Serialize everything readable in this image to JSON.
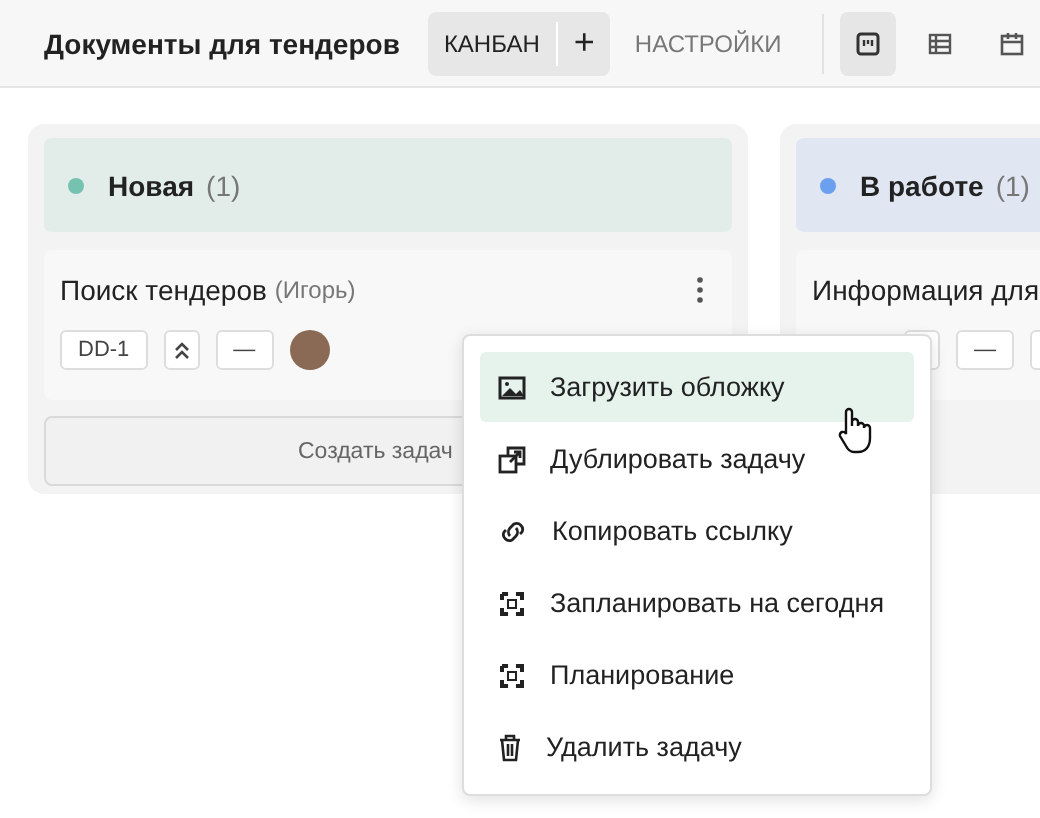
{
  "header": {
    "title": "Документы для тендеров",
    "tabs": [
      {
        "label": "КАНБАН",
        "selected": true
      },
      {
        "label": "НАСТРОЙКИ",
        "selected": false
      }
    ],
    "add_label": "+",
    "views": [
      {
        "kind": "kanban",
        "selected": true
      },
      {
        "kind": "table",
        "selected": false
      },
      {
        "kind": "calendar",
        "selected": false
      }
    ]
  },
  "columns": [
    {
      "name": "Новая",
      "count": "(1)",
      "color": "#76c2b0",
      "cards": [
        {
          "title": "Поиск тендеров",
          "assignee": "(Игорь)",
          "badges": [
            {
              "kind": "id",
              "text": "DD-1"
            },
            {
              "kind": "priority"
            },
            {
              "kind": "text",
              "text": "—"
            },
            {
              "kind": "avatar"
            }
          ]
        }
      ],
      "create_label": "Создать задач"
    },
    {
      "name": "В работе",
      "count": "(1)",
      "color": "#6aa0ee",
      "cards": [
        {
          "title": "Информация для",
          "badges": [
            {
              "kind": "priority"
            },
            {
              "kind": "text",
              "text": "—"
            },
            {
              "kind": "date"
            }
          ]
        }
      ]
    }
  ],
  "menu": {
    "items": [
      {
        "kind": "image",
        "label": "Загрузить обложку",
        "selected": true
      },
      {
        "kind": "duplicate",
        "label": "Дублировать задачу",
        "selected": false
      },
      {
        "kind": "link",
        "label": "Копировать ссылку",
        "selected": false
      },
      {
        "kind": "schedule",
        "label": "Запланировать на сегодня",
        "selected": false
      },
      {
        "kind": "schedule",
        "label": "Планирование",
        "selected": false
      },
      {
        "kind": "trash",
        "label": "Удалить задачу",
        "selected": false
      }
    ]
  }
}
